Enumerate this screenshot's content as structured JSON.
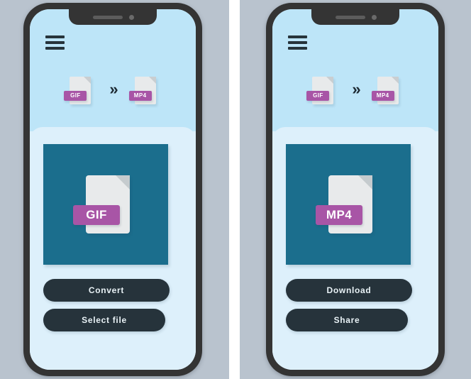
{
  "theme": {
    "page_background": "#b9c3ce",
    "phone_frame": "#343434",
    "header_blue": "#bde5f8",
    "panel_blue": "#ddf0fb",
    "preview_teal": "#1b6e8d",
    "badge_purple": "#a855a6",
    "button_navy": "#26333b",
    "file_paper": "#e8eaeb"
  },
  "screens": [
    {
      "id": "convert-screen",
      "menu_icon": "hamburger-menu-icon",
      "conversion": {
        "source_label": "GIF",
        "arrow_glyph": "»",
        "target_label": "MP4"
      },
      "preview": {
        "file_label": "GIF"
      },
      "buttons": [
        {
          "id": "convert",
          "label": "Convert"
        },
        {
          "id": "select-file",
          "label": "Select file"
        }
      ]
    },
    {
      "id": "result-screen",
      "menu_icon": "hamburger-menu-icon",
      "conversion": {
        "source_label": "GIF",
        "arrow_glyph": "»",
        "target_label": "MP4"
      },
      "preview": {
        "file_label": "MP4"
      },
      "buttons": [
        {
          "id": "download",
          "label": "Download"
        },
        {
          "id": "share",
          "label": "Share"
        }
      ]
    }
  ]
}
